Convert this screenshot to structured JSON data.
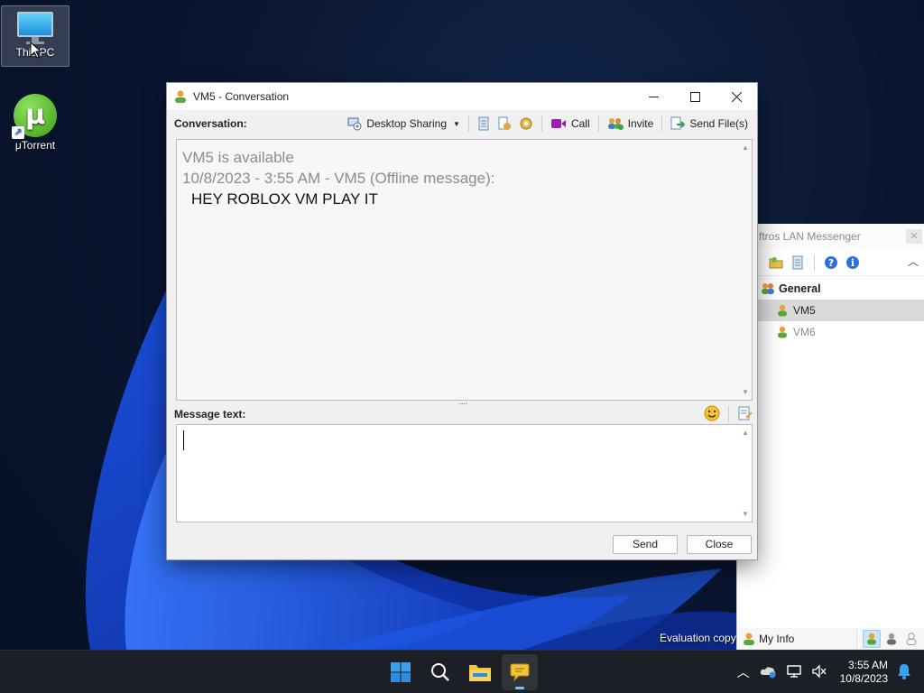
{
  "desktop": {
    "icons": [
      {
        "label": "This PC"
      },
      {
        "label": "μTorrent"
      }
    ],
    "evaluation_text": "Evaluation copy"
  },
  "messenger": {
    "title": "ftros LAN Messenger",
    "group": "General",
    "users": [
      {
        "name": "VM5",
        "status": "online"
      },
      {
        "name": "VM6",
        "status": "offline"
      }
    ],
    "footer_label": "My Info"
  },
  "conversation": {
    "title": "VM5 - Conversation",
    "conversation_label": "Conversation:",
    "toolbar": {
      "desktop_sharing": "Desktop Sharing",
      "call": "Call",
      "invite": "Invite",
      "send_files": "Send File(s)"
    },
    "history": {
      "status_line": "VM5 is available",
      "header_line": "10/8/2023 - 3:55 AM - VM5 (Offline message):",
      "message": "HEY ROBLOX VM PLAY IT"
    },
    "message_label": "Message text:",
    "input_value": "",
    "send_label": "Send",
    "close_label": "Close"
  },
  "taskbar": {
    "time": "3:55 AM",
    "date": "10/8/2023"
  },
  "colors": {
    "accent": "#0a5fd1",
    "online_green": "#58a836",
    "offline_gray": "#8a8a8a"
  }
}
